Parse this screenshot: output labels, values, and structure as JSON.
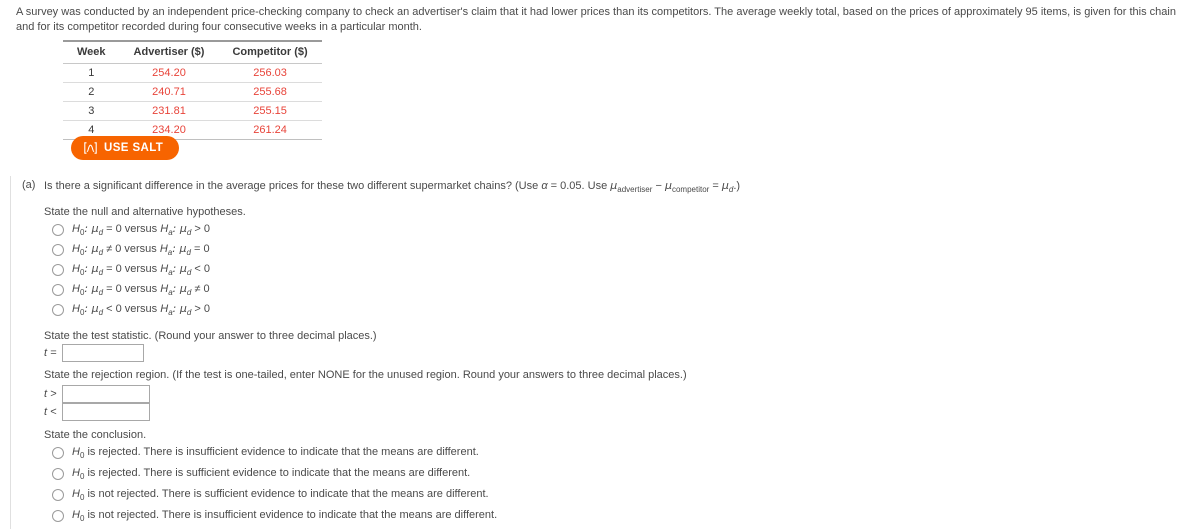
{
  "intro": {
    "paragraph": "A survey was conducted by an independent price-checking company to check an advertiser's claim that it had lower prices than its competitors. The average weekly total, based on the prices of approximately 95 items, is given for this chain and for its competitor recorded during four consecutive weeks in a particular month."
  },
  "table": {
    "headers": [
      "Week",
      "Advertiser ($)",
      "Competitor ($)"
    ],
    "rows": [
      [
        "1",
        "254.20",
        "256.03"
      ],
      [
        "2",
        "240.71",
        "255.68"
      ],
      [
        "3",
        "231.81",
        "255.15"
      ],
      [
        "4",
        "234.20",
        "261.24"
      ]
    ],
    "value_color": "#e8443a"
  },
  "salt_button": {
    "label": "USE SALT",
    "icon": "distribution-curve-icon",
    "background": "#f76400",
    "text_color": "#ffffff"
  },
  "part_a": {
    "marker": "(a)",
    "question_pre": "Is there a significant difference in the average prices for these two different supermarket chains? (Use ",
    "alpha_symbol": "α",
    "alpha_eq": " = 0.05. Use ",
    "mu1": "μ",
    "mu1_sub": "advertiser",
    "minus": " − ",
    "mu2": "μ",
    "mu2_sub": "competitor",
    "equals": " = ",
    "mu3": "μ",
    "mu3_sub": "d",
    "question_post": ".)"
  },
  "hypotheses": {
    "heading": "State the null and alternative hypotheses.",
    "options": [
      {
        "h0": "H",
        "h0_sub": "0",
        "h0_rest": ": μ",
        "h0_mu_sub": "d",
        "h0_tail": " = 0 versus ",
        "ha": "H",
        "ha_sub": "a",
        "ha_rest": ": μ",
        "ha_mu_sub": "d",
        "ha_tail": " > 0"
      },
      {
        "h0": "H",
        "h0_sub": "0",
        "h0_rest": ": μ",
        "h0_mu_sub": "d",
        "h0_tail": " ≠ 0 versus ",
        "ha": "H",
        "ha_sub": "a",
        "ha_rest": ": μ",
        "ha_mu_sub": "d",
        "ha_tail": " = 0"
      },
      {
        "h0": "H",
        "h0_sub": "0",
        "h0_rest": ": μ",
        "h0_mu_sub": "d",
        "h0_tail": " = 0 versus ",
        "ha": "H",
        "ha_sub": "a",
        "ha_rest": ": μ",
        "ha_mu_sub": "d",
        "ha_tail": " < 0"
      },
      {
        "h0": "H",
        "h0_sub": "0",
        "h0_rest": ": μ",
        "h0_mu_sub": "d",
        "h0_tail": " = 0 versus ",
        "ha": "H",
        "ha_sub": "a",
        "ha_rest": ": μ",
        "ha_mu_sub": "d",
        "ha_tail": " ≠ 0"
      },
      {
        "h0": "H",
        "h0_sub": "0",
        "h0_rest": ": μ",
        "h0_mu_sub": "d",
        "h0_tail": " < 0 versus ",
        "ha": "H",
        "ha_sub": "a",
        "ha_rest": ": μ",
        "ha_mu_sub": "d",
        "ha_tail": " > 0"
      }
    ]
  },
  "test_statistic": {
    "heading": "State the test statistic. (Round your answer to three decimal places.)",
    "label": "t =",
    "value": "",
    "placeholder": ""
  },
  "rejection_region": {
    "heading": "State the rejection region. (If the test is one-tailed, enter NONE for the unused region. Round your answers to three decimal places.)",
    "greater_label": "t >",
    "greater_value": "",
    "less_label": "t <",
    "less_value": "",
    "placeholder": ""
  },
  "conclusion": {
    "heading": "State the conclusion.",
    "options": [
      {
        "h": "H",
        "sub": "0",
        "text": " is rejected. There is insufficient evidence to indicate that the means are different."
      },
      {
        "h": "H",
        "sub": "0",
        "text": " is rejected. There is sufficient evidence to indicate that the means are different."
      },
      {
        "h": "H",
        "sub": "0",
        "text": " is not rejected. There is sufficient evidence to indicate that the means are different."
      },
      {
        "h": "H",
        "sub": "0",
        "text": " is not rejected. There is insufficient evidence to indicate that the means are different."
      }
    ]
  }
}
